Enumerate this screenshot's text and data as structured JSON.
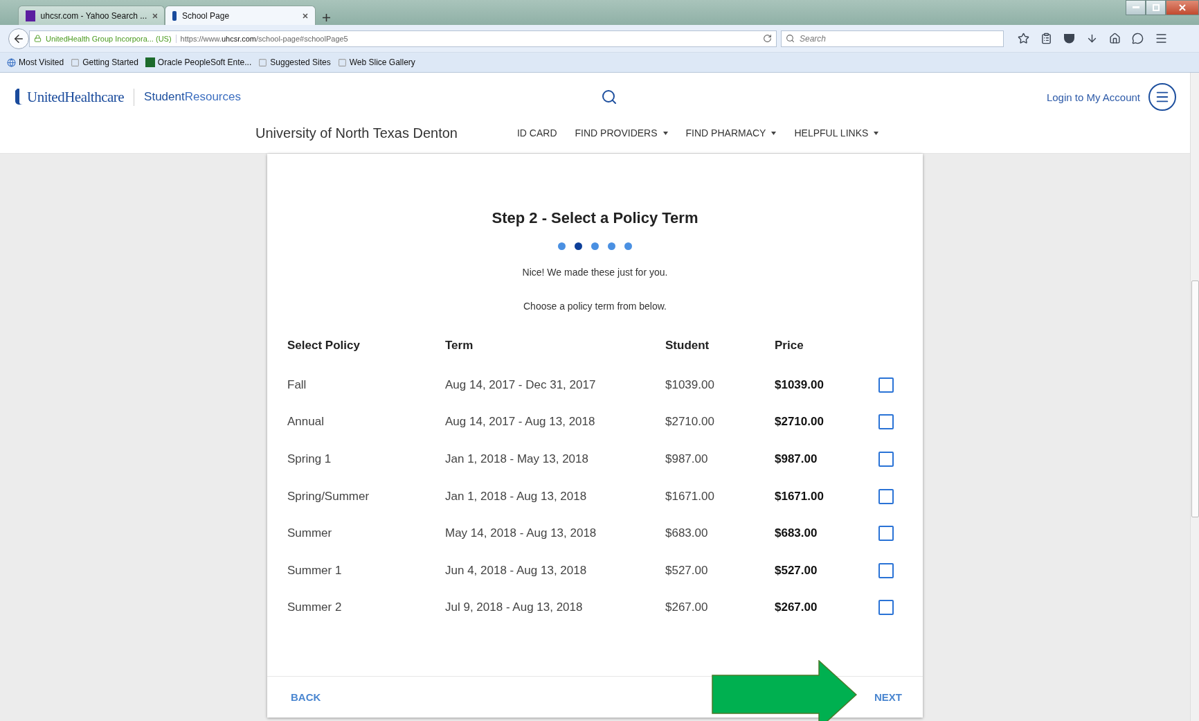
{
  "browser": {
    "tabs": [
      {
        "title": "uhcsr.com - Yahoo Search ...",
        "selected": false,
        "kind": "yahoo"
      },
      {
        "title": "School Page",
        "selected": true,
        "kind": "site"
      }
    ],
    "identity": "UnitedHealth Group Incorpora... (US)",
    "url": "https://www.**uhcsr.com**/school-page#schoolPage5",
    "search": {
      "placeholder": "Search"
    },
    "bookmarks": [
      {
        "label": "Most Visited",
        "kind": "globe"
      },
      {
        "label": "Getting Started",
        "kind": "page"
      },
      {
        "label": "Oracle PeopleSoft Ente...",
        "kind": "oracle"
      },
      {
        "label": "Suggested Sites",
        "kind": "page"
      },
      {
        "label": "Web Slice Gallery",
        "kind": "page"
      }
    ]
  },
  "site": {
    "brand": "UnitedHealthcare",
    "section": "**Student**Resources",
    "login": "Login to My Account",
    "school": "University of North Texas Denton",
    "nav": [
      {
        "label": "ID CARD",
        "dropdown": false
      },
      {
        "label": "FIND PROVIDERS",
        "dropdown": true
      },
      {
        "label": "FIND PHARMACY",
        "dropdown": true
      },
      {
        "label": "HELPFUL LINKS",
        "dropdown": true
      }
    ]
  },
  "wizard": {
    "title": "Step 2 - Select a Policy Term",
    "steps": [
      {
        "selected": false
      },
      {
        "selected": true
      },
      {
        "selected": false
      },
      {
        "selected": false
      },
      {
        "selected": false
      }
    ],
    "lines": [
      "Nice! We made these just for you.",
      "Choose a policy term from below."
    ],
    "columns": [
      "Select Policy",
      "Term",
      "Student",
      "Price"
    ],
    "rows": [
      {
        "policy": "Fall",
        "term": "Aug 14, 2017 - Dec 31, 2017",
        "student": "$1039.00",
        "price": "$1039.00",
        "checked": false
      },
      {
        "policy": "Annual",
        "term": "Aug 14, 2017 - Aug 13, 2018",
        "student": "$2710.00",
        "price": "$2710.00",
        "checked": false
      },
      {
        "policy": "Spring 1",
        "term": "Jan 1, 2018 - May 13, 2018",
        "student": "$987.00",
        "price": "$987.00",
        "checked": false
      },
      {
        "policy": "Spring/Summer",
        "term": "Jan 1, 2018 - Aug 13, 2018",
        "student": "$1671.00",
        "price": "$1671.00",
        "checked": false
      },
      {
        "policy": "Summer",
        "term": "May 14, 2018 - Aug 13, 2018",
        "student": "$683.00",
        "price": "$683.00",
        "checked": false
      },
      {
        "policy": "Summer 1",
        "term": "Jun 4, 2018 - Aug 13, 2018",
        "student": "$527.00",
        "price": "$527.00",
        "checked": false
      },
      {
        "policy": "Summer 2",
        "term": "Jul 9, 2018 - Aug 13, 2018",
        "student": "$267.00",
        "price": "$267.00",
        "checked": false
      }
    ],
    "back": "BACK",
    "next": "NEXT"
  }
}
